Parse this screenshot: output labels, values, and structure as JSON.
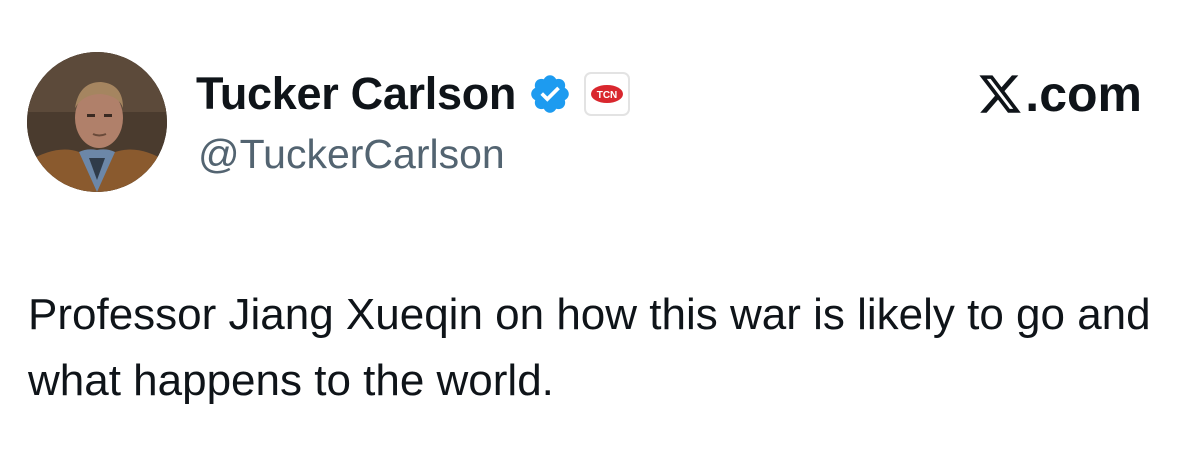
{
  "author": {
    "display_name": "Tucker Carlson",
    "handle": "@TuckerCarlson",
    "verified_icon": "verified-badge-icon",
    "affiliate_badge": "TCN"
  },
  "brand": {
    "site_label": ".com",
    "logo": "x-logo-icon"
  },
  "tweet": {
    "text": "Professor Jiang Xueqin on how this war is likely to go and what happens to the world."
  },
  "colors": {
    "text": "#0f1419",
    "secondary_text": "#536471",
    "verified_blue": "#1d9bf0",
    "affiliate_red": "#d9272e"
  }
}
